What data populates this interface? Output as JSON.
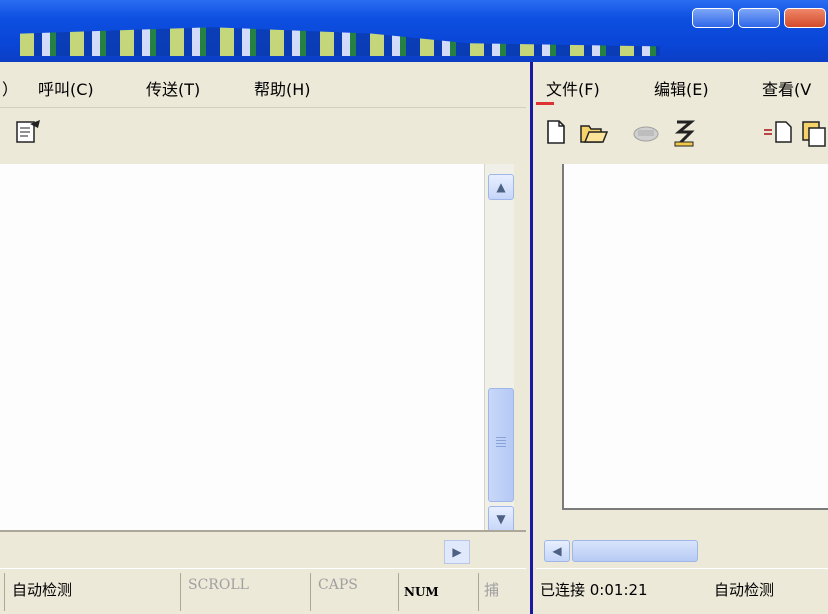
{
  "left": {
    "menu": [
      "）",
      "呼叫(C)",
      "传送(T)",
      "帮助(H)"
    ],
    "status": {
      "detect": "自动检测",
      "scroll": "SCROLL",
      "caps": "CAPS",
      "num": "NUM",
      "capture": "捕"
    }
  },
  "right": {
    "menu": [
      "文件(F)",
      "编辑(E)",
      "查看(V"
    ],
    "status": {
      "connected": "已连接 0:01:21",
      "detect": "自动检测"
    }
  },
  "icons": {
    "left_toolbar": [
      "properties-icon"
    ],
    "right_toolbar": [
      "new-icon",
      "open-icon",
      "disconnect-icon",
      "send-icon",
      "properties-icon",
      "copy-icon"
    ]
  }
}
